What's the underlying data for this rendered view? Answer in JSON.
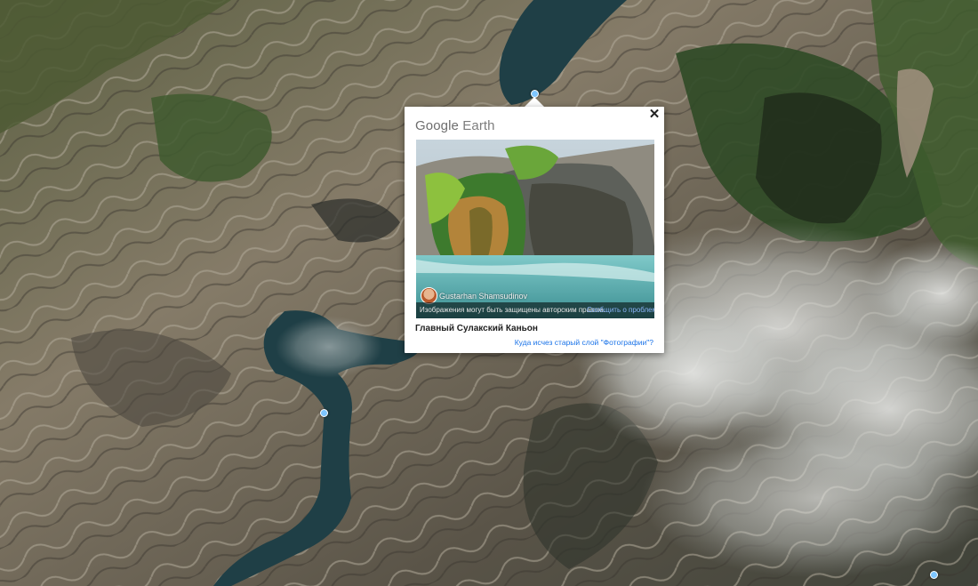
{
  "popup": {
    "brand_google": "Google",
    "brand_earth": "Earth",
    "close_glyph": "✕",
    "photo_author": "Gustarhan Shamsudinov",
    "copyright_notice": "Изображения могут быть защищены авторским правом.",
    "report_link": "Сообщить о проблеме",
    "place_title": "Главный Сулакский Каньон",
    "layer_link": "Куда исчез старый слой \"Фотографии\"?"
  },
  "colors": {
    "link_blue": "#1a73e8",
    "report_blue": "#8ab4f8",
    "pin_blue": "#7ec6ff",
    "water": "#1f3f46"
  },
  "icons": {
    "close": "close-icon",
    "pin": "location-pin-icon",
    "avatar": "user-avatar"
  }
}
